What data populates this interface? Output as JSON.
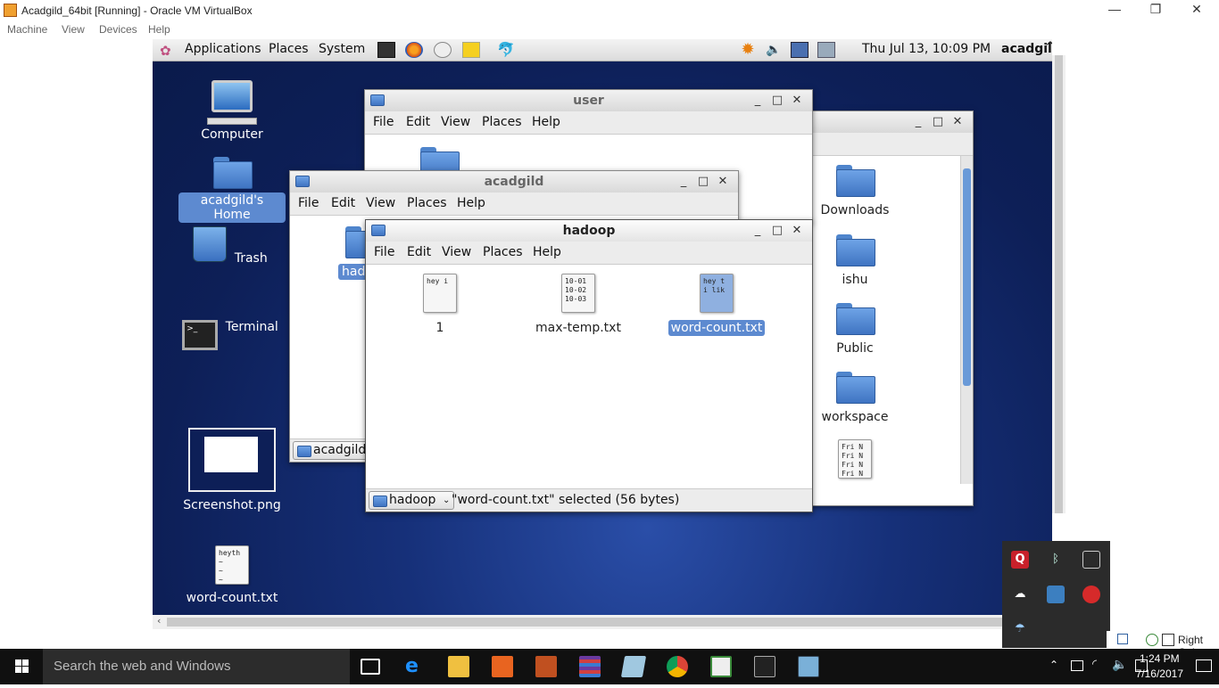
{
  "host": {
    "title": "Acadgild_64bit [Running] - Oracle VM VirtualBox",
    "menu": [
      "Machine",
      "View",
      "Devices",
      "Help"
    ],
    "host_key": "Right Ctrl"
  },
  "guest_panel": {
    "menus": [
      "Applications",
      "Places",
      "System"
    ],
    "datetime": "Thu Jul 13, 10:09 PM",
    "user": "acadgil"
  },
  "desktop": {
    "icons": [
      "Computer",
      "acadgild's Home",
      "Trash",
      "Terminal",
      "Screenshot.png",
      "word-count.txt"
    ],
    "word_count_preview": "heyth\n~\n~\n~"
  },
  "windows": {
    "user": {
      "title": "user"
    },
    "acadgild": {
      "title": "acadgild",
      "folder_label": "had",
      "crumb": "acadgild"
    },
    "hadoop": {
      "title": "hadoop",
      "files": [
        {
          "name": "1",
          "preview": "hey i"
        },
        {
          "name": "max-temp.txt",
          "preview": "10-01\n10-02\n10-03"
        },
        {
          "name": "word-count.txt",
          "preview": "hey t\ni lik"
        }
      ],
      "crumb": "hadoop",
      "status": "\"word-count.txt\" selected (56 bytes)"
    },
    "home": {
      "items": [
        "Downloads",
        "ishu",
        "Public",
        "workspace"
      ],
      "file_preview": "Fri N\nFri N\nFri N\nFri N"
    }
  },
  "window_menu": [
    "File",
    "Edit",
    "View",
    "Places",
    "Help"
  ],
  "taskbar": {
    "search_placeholder": "Search the web and Windows",
    "time": "1:24 PM",
    "date": "7/16/2017"
  }
}
